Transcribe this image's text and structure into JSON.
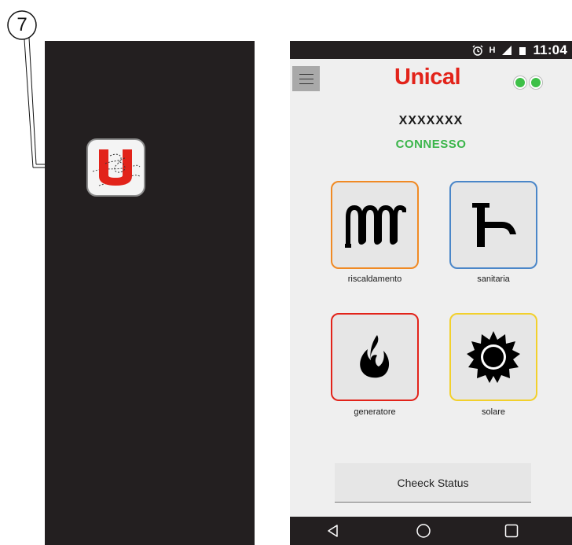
{
  "callout": {
    "number": "7"
  },
  "status_bar": {
    "time": "11:04",
    "network_letter": "H",
    "icons": [
      "alarm-icon",
      "signal-icon",
      "battery-icon"
    ]
  },
  "header": {
    "logo_text": "Unical",
    "logo_color": "#e2231a",
    "connection_dots_color": "#3ec048"
  },
  "device": {
    "name": "XXXXXXX",
    "status": "CONNESSO",
    "status_color": "#3bb54a"
  },
  "tiles": [
    {
      "label": "riscaldamento",
      "icon": "radiator-icon",
      "border_color": "#f08a24"
    },
    {
      "label": "sanitaria",
      "icon": "faucet-icon",
      "border_color": "#4a86c8"
    },
    {
      "label": "generatore",
      "icon": "flame-icon",
      "border_color": "#e2231a"
    },
    {
      "label": "solare",
      "icon": "sun-icon",
      "border_color": "#f2d02c"
    }
  ],
  "check_button": {
    "label": "Cheeck Status"
  },
  "nav_bar": {
    "icons": [
      "back-icon",
      "home-icon",
      "recents-icon"
    ]
  }
}
